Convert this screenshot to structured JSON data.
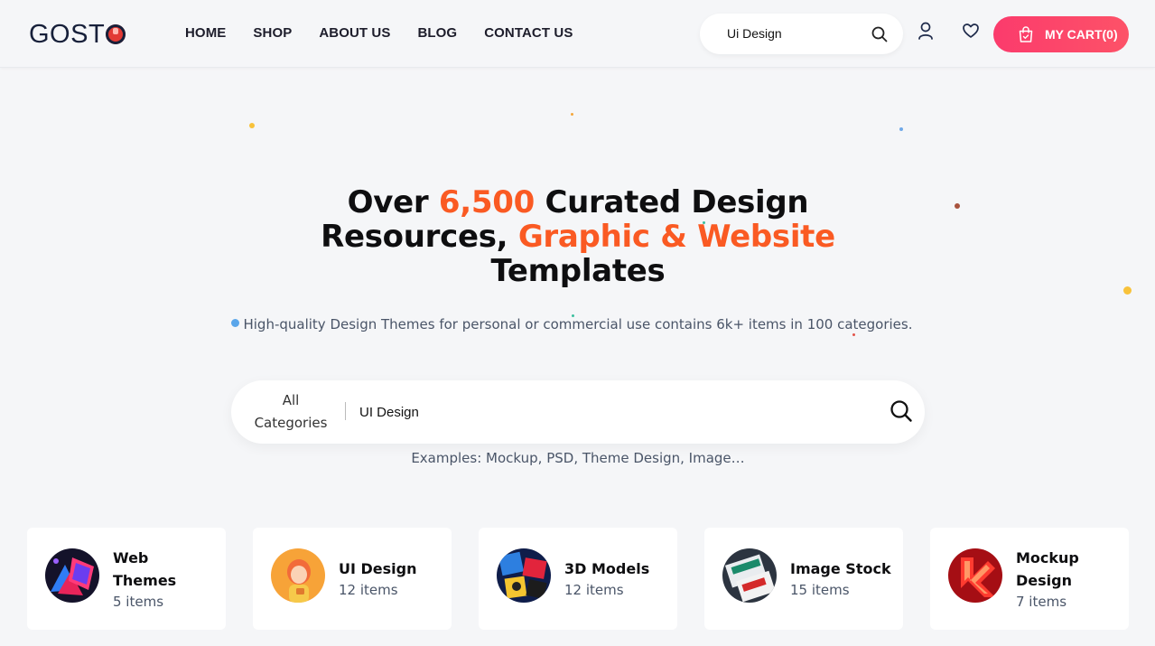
{
  "header": {
    "logo_text": "GOST",
    "nav": [
      "HOME",
      "SHOP",
      "ABOUT US",
      "BLOG",
      "CONTACT US"
    ],
    "search_value": "Ui Design",
    "cart_label": "MY CART(0)"
  },
  "hero": {
    "title_part1": "Over ",
    "title_accent1": "6,500",
    "title_part2": " Curated Design Resources, ",
    "title_accent2": "Graphic & Website",
    "title_part3": " Templates",
    "subtitle": "High-quality Design Themes for personal or commercial use contains 6k+ items in 100 categories.",
    "search": {
      "category_label_line1": "All",
      "category_label_line2": "Categories",
      "value": "UI Design"
    },
    "examples": "Examples: Mockup, PSD, Theme Design, Image…"
  },
  "categories": [
    {
      "name": "Web Themes",
      "count": "5 items",
      "icon": "web-themes-thumbnail"
    },
    {
      "name": "UI Design",
      "count": "12 items",
      "icon": "ui-design-thumbnail"
    },
    {
      "name": "3D Models",
      "count": "12 items",
      "icon": "3d-models-thumbnail"
    },
    {
      "name": "Image Stock",
      "count": "15 items",
      "icon": "image-stock-thumbnail"
    },
    {
      "name": "Mockup Design",
      "count": "7 items",
      "icon": "mockup-design-thumbnail"
    }
  ],
  "colors": {
    "accent": "#fa5a23",
    "cart": "#fb3b6c",
    "background": "#f5f6f8"
  }
}
